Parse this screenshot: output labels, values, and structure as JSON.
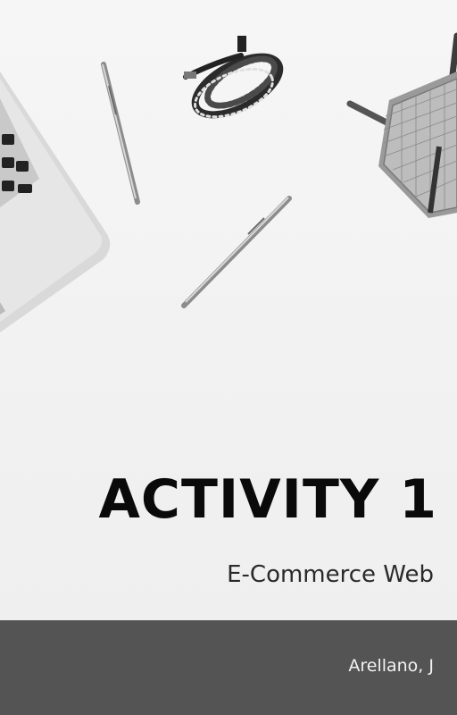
{
  "cover": {
    "title": "ACTIVITY 1",
    "subtitle": "E-Commerce Web",
    "author": "Arellano, J"
  },
  "colors": {
    "footer_band": "#545454",
    "background": "#f2f2f2",
    "title_text": "#0a0a0a"
  }
}
